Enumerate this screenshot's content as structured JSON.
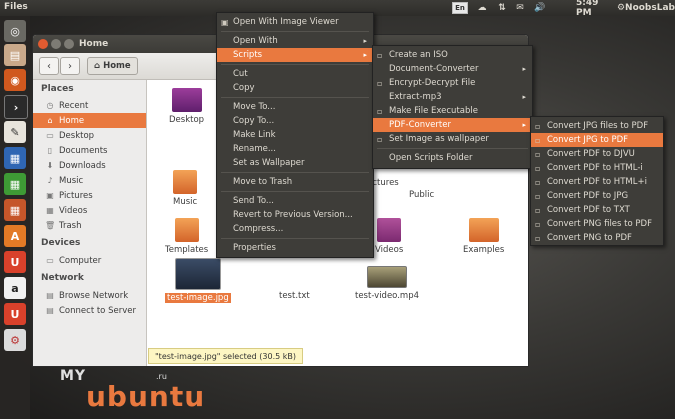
{
  "topbar": {
    "app_title": "Files",
    "keyboard_layout": "En",
    "time": "5:49 PM",
    "user": "NoobsLab"
  },
  "window": {
    "title": "Home",
    "breadcrumb": "Home"
  },
  "sidebar": {
    "places_heading": "Places",
    "places": [
      "Recent",
      "Home",
      "Desktop",
      "Documents",
      "Downloads",
      "Music",
      "Pictures",
      "Videos",
      "Trash"
    ],
    "devices_heading": "Devices",
    "devices": [
      "Computer"
    ],
    "network_heading": "Network",
    "network": [
      "Browse Network",
      "Connect to Server"
    ]
  },
  "files": {
    "desktop": "Desktop",
    "music": "Music",
    "templates": "Templates",
    "public": "Public",
    "pictures_partial": "ictures",
    "videos": "Videos",
    "examples": "Examples",
    "test_image": "test-image.jpg",
    "test_text": "test.txt",
    "test_video": "test-video.mp4"
  },
  "status": "\"test-image.jpg\" selected  (30.5 kB)",
  "context_menu": {
    "open_with_viewer": "Open With Image Viewer",
    "open_with": "Open With",
    "scripts": "Scripts",
    "cut": "Cut",
    "copy": "Copy",
    "move_to": "Move To...",
    "copy_to": "Copy To...",
    "make_link": "Make Link",
    "rename": "Rename...",
    "set_wallpaper": "Set as Wallpaper",
    "move_trash": "Move to Trash",
    "send_to": "Send To...",
    "revert": "Revert to Previous Version...",
    "compress": "Compress...",
    "properties": "Properties"
  },
  "scripts_menu": {
    "create_iso": "Create an ISO",
    "document_converter": "Document-Converter",
    "encrypt_decrypt": "Encrypt-Decrypt File",
    "extract_mp3": "Extract-mp3",
    "make_executable": "Make File Executable",
    "pdf_converter": "PDF-Converter",
    "set_wallpaper": "Set Image as wallpaper",
    "open_scripts_folder": "Open Scripts Folder"
  },
  "pdf_menu": {
    "items": [
      "Convert JPG files to PDF",
      "Convert JPG to PDF",
      "Convert PDF to DJVU",
      "Convert PDF to HTML-i",
      "Convert PDF to HTML+i",
      "Convert PDF to JPG",
      "Convert PDF to TXT",
      "Convert PNG files to PDF",
      "Convert PNG to PDF"
    ]
  },
  "watermark": {
    "my": "MY",
    "ru": ".ru",
    "ubuntu": "ubuntu"
  },
  "colors": {
    "accent": "#e9793f",
    "panel": "#3c3b37",
    "menu_bg": "#3e3d39"
  }
}
